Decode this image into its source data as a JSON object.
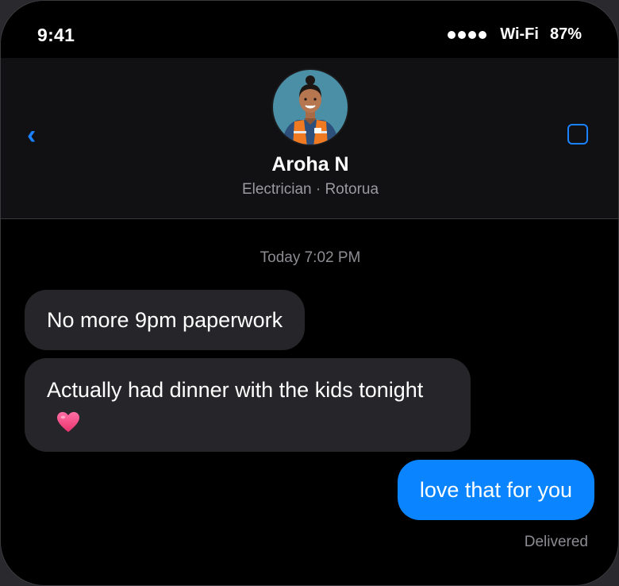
{
  "status_bar": {
    "time": "9:41",
    "network": "Wi-Fi",
    "battery": "87%",
    "signal_bars": 4
  },
  "header": {
    "back_icon": "chevron-left-icon",
    "contact_name": "Aroha N",
    "contact_subtitle": "Electrician · Rotorua",
    "action_icon": "video-icon",
    "accent_color": "#1a82ff"
  },
  "conversation": {
    "timestamp": "Today 7:02 PM",
    "messages": [
      {
        "direction": "incoming",
        "text": "No more 9pm paperwork"
      },
      {
        "direction": "incoming",
        "text": "Actually had dinner with the kids tonight",
        "emoji": "heart-icon"
      },
      {
        "direction": "outgoing",
        "text": "love that for you"
      }
    ],
    "delivery_status": "Delivered"
  },
  "colors": {
    "outgoing_bubble": "#0a84ff",
    "incoming_bubble": "#26262a",
    "background": "#000000"
  }
}
